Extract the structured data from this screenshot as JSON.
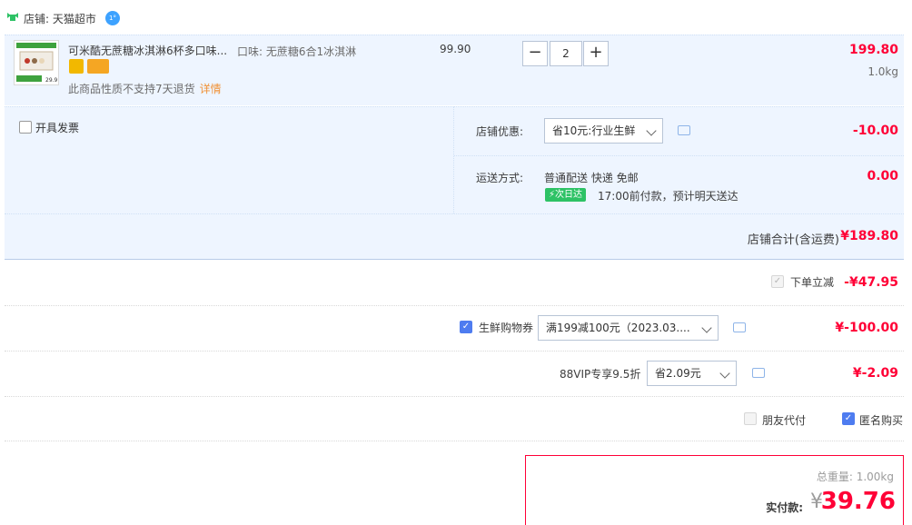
{
  "store": {
    "label": "店铺: 天猫超市",
    "chat_badge": "1°"
  },
  "item": {
    "title": "可米酷无蔗糖冰淇淋6杯多口味...",
    "sku": "口味: 无蔗糖6合1冰淇淋",
    "unit_price": "99.90",
    "quantity": "2",
    "line_total": "199.80",
    "weight": "1.0kg",
    "note": "此商品性质不支持7天退货",
    "detail_link": "详情",
    "thumb_price": "29.9"
  },
  "options": {
    "invoice_label": "开具发票",
    "discount_label": "店铺优惠:",
    "discount_select": "省10元:行业生鲜",
    "discount_amount": "-10.00",
    "shipping_label": "运送方式:",
    "shipping_method": "普通配送 快递 免邮",
    "shipping_badge": "次日达",
    "shipping_eta": "17:00前付款，预计明天送达",
    "shipping_amount": "0.00"
  },
  "store_total": {
    "label": "店铺合计(含运费)",
    "amount": "¥189.80"
  },
  "order": {
    "instant_label": "下单立减",
    "instant_amount": "-¥47.95",
    "coupon_label": "生鲜购物券",
    "coupon_select": "满199减100元（2023.03....",
    "coupon_amount": "¥-100.00",
    "vip_label": "88VIP专享9.5折",
    "vip_select": "省2.09元",
    "vip_amount": "¥-2.09",
    "friend_pay_label": "朋友代付",
    "anonymous_label": "匿名购买"
  },
  "pay": {
    "total_weight": "总重量: 1.00kg",
    "label": "实付款:",
    "currency": "¥",
    "amount": "39.76"
  },
  "colors": {
    "accent_red": "#ff0036",
    "panel_blue": "#eef5ff",
    "checkbox_blue": "#4e7cf0",
    "badge_green": "#2dc265"
  }
}
